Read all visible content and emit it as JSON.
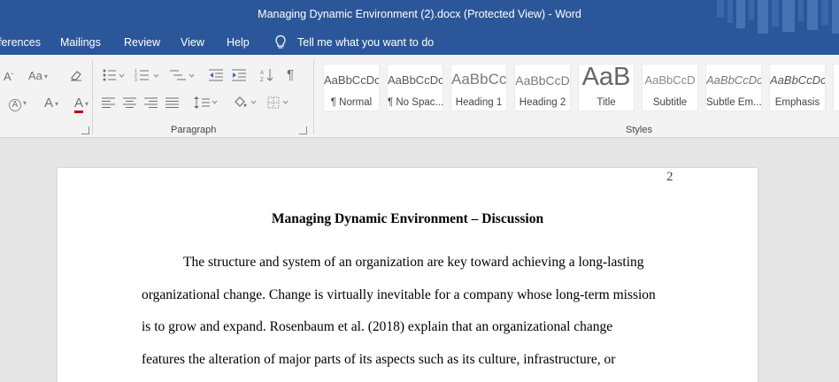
{
  "window": {
    "title": "Managing Dynamic Environment (2).docx (Protected View)  -  Word"
  },
  "tabs": [
    "ferences",
    "Mailings",
    "Review",
    "View",
    "Help"
  ],
  "tell_me": "Tell me what you want to do",
  "ribbon": {
    "font_group": {
      "change_case_label": "Aa",
      "font_color_letter": "A",
      "highlight_letter": "A",
      "grow_letter": "A"
    },
    "paragraph_label": "Paragraph",
    "styles_label": "Styles",
    "styles": [
      {
        "sample": "AaBbCcDc",
        "name": "¶ Normal"
      },
      {
        "sample": "AaBbCcDc",
        "name": "¶ No Spac..."
      },
      {
        "sample": "AaBbCc",
        "name": "Heading 1"
      },
      {
        "sample": "AaBbCcD",
        "name": "Heading 2"
      },
      {
        "sample": "AaB",
        "name": "Title"
      },
      {
        "sample": "AaBbCcD",
        "name": "Subtitle"
      },
      {
        "sample": "AaBbCcDc",
        "name": "Subtle Em..."
      },
      {
        "sample": "AaBbCcDc",
        "name": "Emphasis"
      }
    ]
  },
  "document": {
    "page_number": "2",
    "title": "Managing Dynamic Environment – Discussion",
    "lines": [
      "The structure and system of an organization are key toward achieving a long-lasting",
      "organizational change. Change is virtually inevitable for a company whose long-term mission",
      "is to grow and expand. Rosenbaum et al. (2018) explain that an organizational change",
      "features the alteration of major parts of its aspects such as its culture, infrastructure, or"
    ]
  },
  "colors": {
    "title_bar": "#2b579a",
    "ribbon_bg": "#f3f3f3",
    "canvas_bg": "#e6e6e6"
  }
}
